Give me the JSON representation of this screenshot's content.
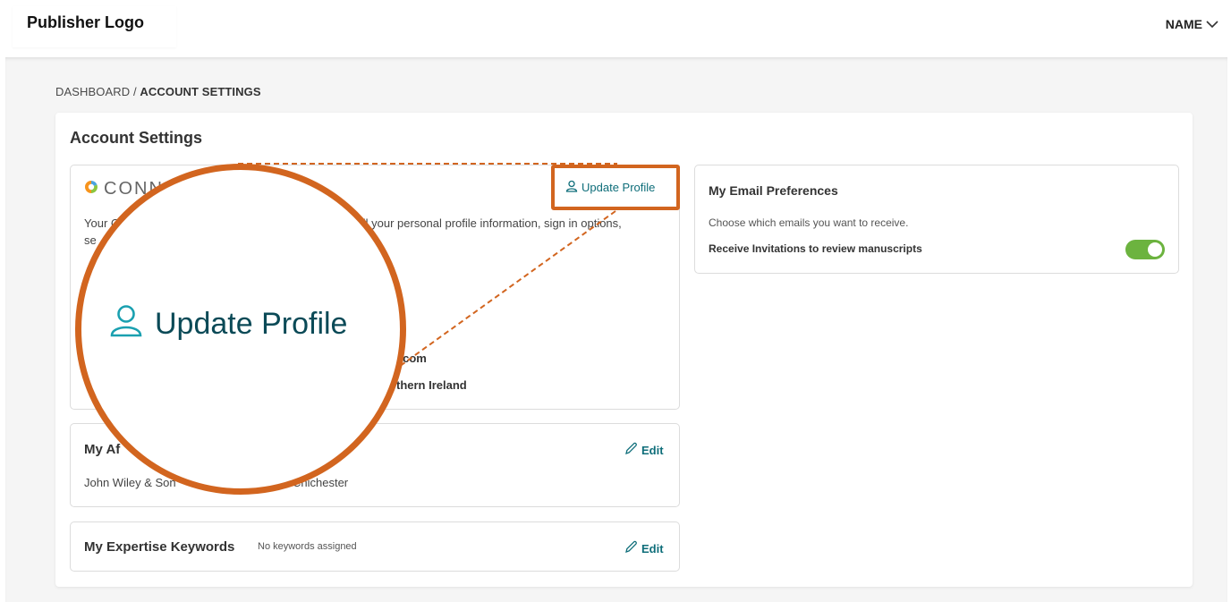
{
  "header": {
    "logo_text": "Publisher Logo",
    "user_name": "NAME"
  },
  "breadcrumb": {
    "root": "DASHBOARD",
    "separator": " / ",
    "current": "ACCOUNT SETTINGS"
  },
  "page": {
    "title": "Account Settings"
  },
  "connect_panel": {
    "logo_text": "CONN",
    "update_label": "Update Profile",
    "description_start": "Your C",
    "description_end": "f all your personal profile information, sign in options,",
    "description_line2": "se",
    "email_partial": "ey.com",
    "country_partial": "orthern Ireland"
  },
  "affiliations_panel": {
    "title": "My Af",
    "edit_label": "Edit",
    "value_start": "John Wiley & Son",
    "value_end": "Chichester"
  },
  "keywords_panel": {
    "title": "My Expertise Keywords",
    "empty_text": "No keywords assigned",
    "edit_label": "Edit"
  },
  "email_prefs": {
    "title": "My Email Preferences",
    "subtitle": "Choose which emails you want to receive.",
    "option_label": "Receive Invitations to review manuscripts",
    "option_enabled": true
  },
  "magnifier": {
    "label": "Update Profile"
  },
  "colors": {
    "accent": "#0f6e7a",
    "highlight": "#d2651f",
    "toggle_on": "#6cb33f"
  },
  "icons": {
    "user": "user-icon",
    "pencil": "pencil-icon",
    "chevron": "chevron-down-icon"
  }
}
